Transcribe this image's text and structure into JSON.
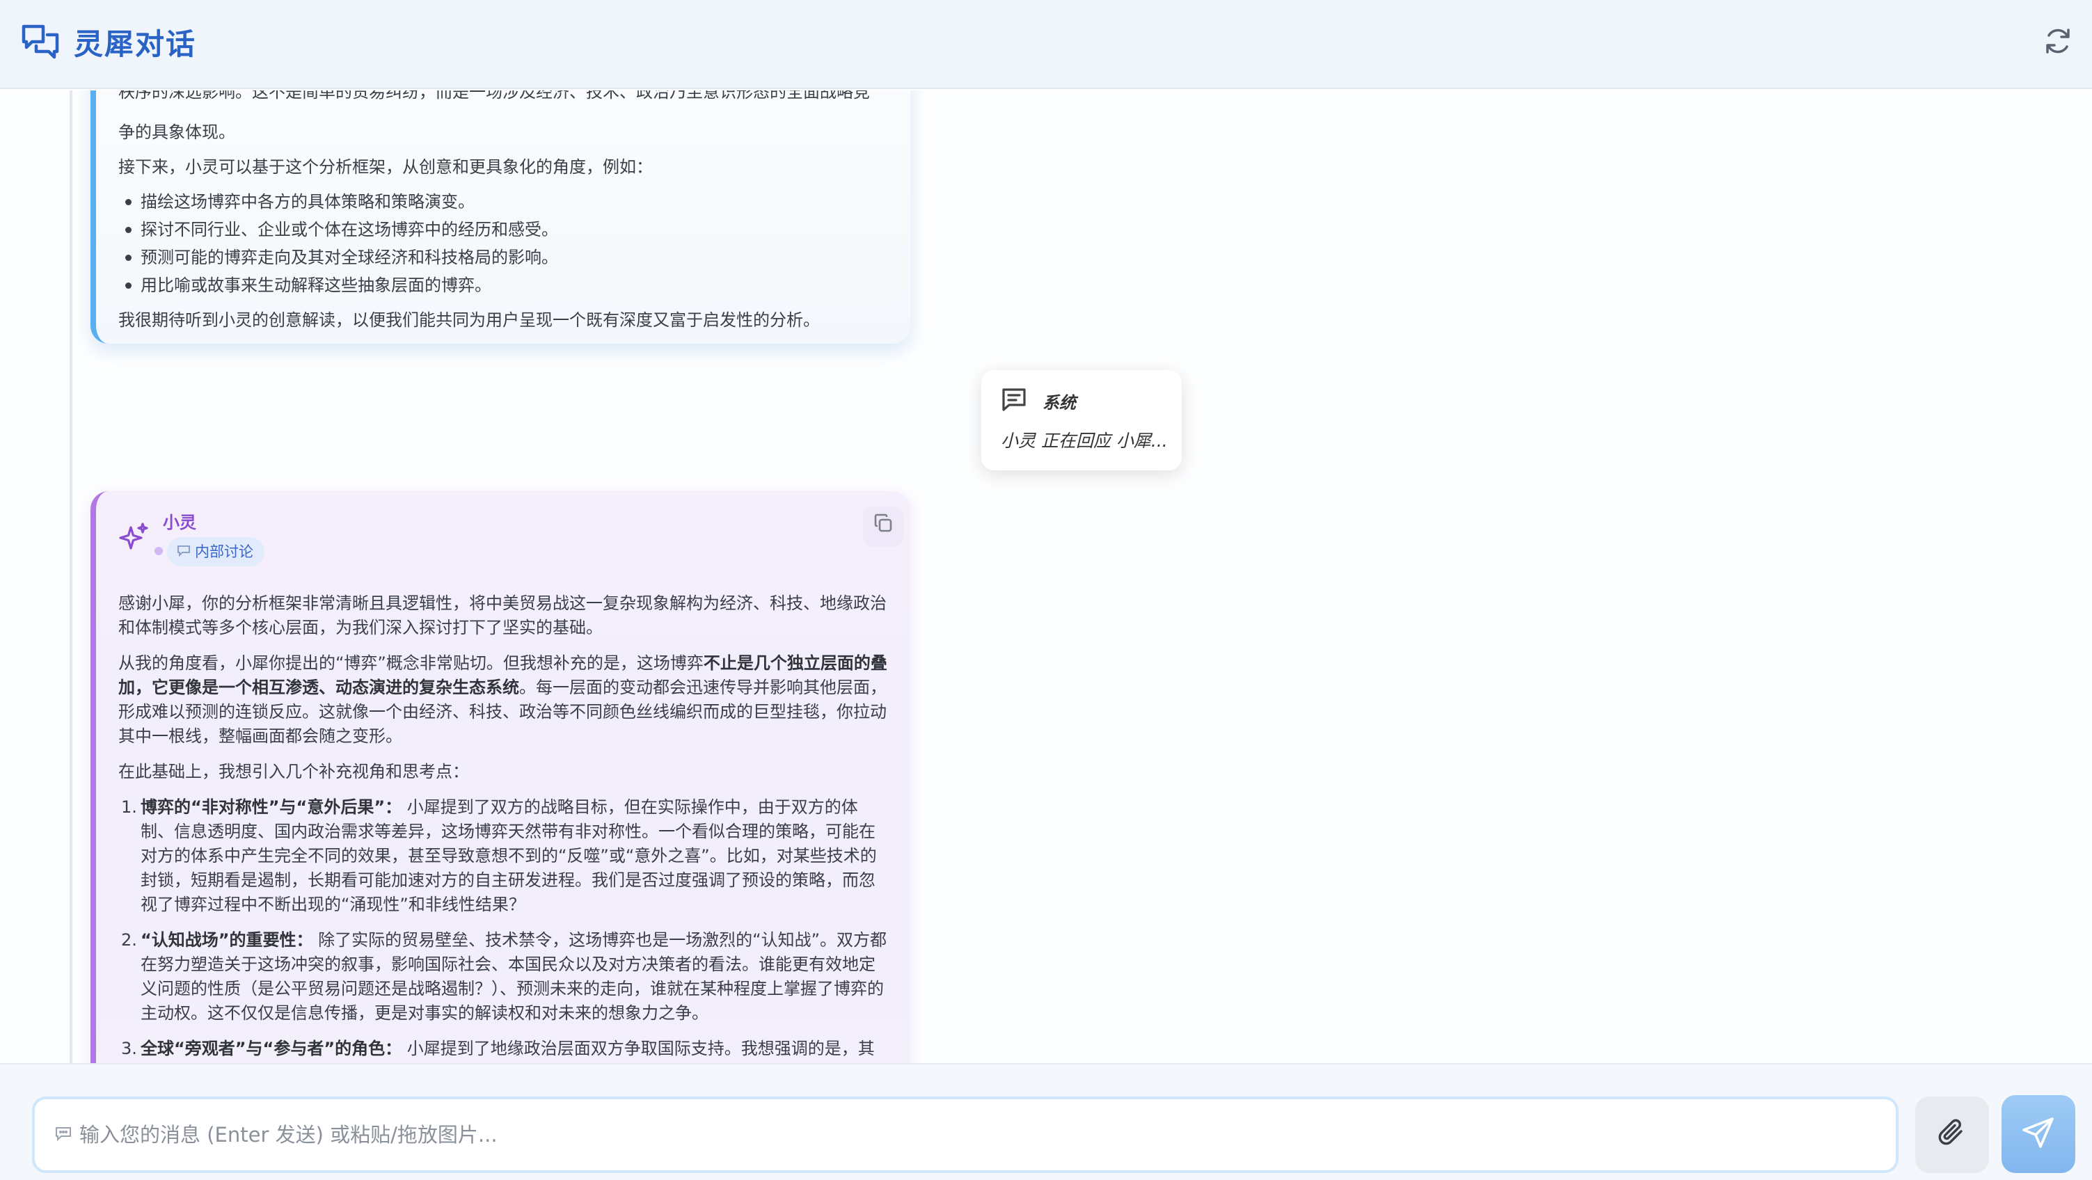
{
  "header": {
    "title": "灵犀对话",
    "logo_icon": "chat-bubbles-icon",
    "refresh_icon": "refresh-icon"
  },
  "message1": {
    "partial_line": "秩序的深远影响。这不是简单的贸易纠纷，而是一场涉及经济、技术、政治乃至意识形态的全面战略竞",
    "para1_end": "争的具象体现。",
    "para2": "接下来，小灵可以基于这个分析框架，从创意和更具象化的角度，例如：",
    "bullets": [
      "描绘这场博弈中各方的具体策略和策略演变。",
      "探讨不同行业、企业或个体在这场博弈中的经历和感受。",
      "预测可能的博弈走向及其对全球经济和科技格局的影响。",
      "用比喻或故事来生动解释这些抽象层面的博弈。"
    ],
    "closing": "我很期待听到小灵的创意解读，以便我们能共同为用户呈现一个既有深度又富于启发性的分析。"
  },
  "system_popup": {
    "icon": "message-icon",
    "title": "系统",
    "text": "小灵 正在回应 小犀..."
  },
  "message2": {
    "author": "小灵",
    "avatar_icon": "sparkle-icon",
    "tag": "内部讨论",
    "tag_icon": "speech-bubble-icon",
    "copy_icon": "copy-icon",
    "para1": "感谢小犀，你的分析框架非常清晰且具逻辑性，将中美贸易战这一复杂现象解构为经济、科技、地缘政治和体制模式等多个核心层面，为我们深入探讨打下了坚实的基础。",
    "para2_a": "从我的角度看，小犀你提出的“博弈”概念非常贴切。但我想补充的是，这场博弈",
    "para2_b": "不止是几个独立层面的叠加，它更像是一个相互渗透、动态演进的复杂生态系统",
    "para2_c": "。每一层面的变动都会迅速传导并影响其他层面，形成难以预测的连锁反应。这就像一个由经济、科技、政治等不同颜色丝线编织而成的巨型挂毯，你拉动其中一根线，整幅画面都会随之变形。",
    "para3": "在此基础上，我想引入几个补充视角和思考点：",
    "items": [
      {
        "num": "1.",
        "title": "博弈的“非对称性”与“意外后果”：",
        "text": " 小犀提到了双方的战略目标，但在实际操作中，由于双方的体制、信息透明度、国内政治需求等差异，这场博弈天然带有非对称性。一个看似合理的策略，可能在对方的体系中产生完全不同的效果，甚至导致意想不到的“反噬”或“意外之喜”。比如，对某些技术的封锁，短期看是遏制，长期看可能加速对方的自主研发进程。我们是否过度强调了预设的策略，而忽视了博弈过程中不断出现的“涌现性”和非线性结果？"
      },
      {
        "num": "2.",
        "title": "“认知战场”的重要性：",
        "text": " 除了实际的贸易壁垒、技术禁令，这场博弈也是一场激烈的“认知战”。双方都在努力塑造关于这场冲突的叙事，影响国际社会、本国民众以及对方决策者的看法。谁能更有效地定义问题的性质（是公平贸易问题还是战略遏制？）、预测未来的走向，谁就在某种程度上掌握了博弈的主动权。这不仅仅是信息传播，更是对事实的解读权和对未来的想象力之争。"
      },
      {
        "num": "3.",
        "title": "全球“旁观者”与“参与者”的角色：",
        "text": " 小犀提到了地缘政治层面双方争取国际支持。我想强调的是，其他国家并非仅仅是旁观者，它们也是这场博弈中不可或缺的参与者，甚至能够主动影响博弈走向。"
      }
    ]
  },
  "composer": {
    "placeholder": "输入您的消息 (Enter 发送) 或粘贴/拖放图片...",
    "value": "",
    "input_icon": "chat-icon",
    "attach_icon": "paperclip-icon",
    "send_icon": "send-icon"
  },
  "colors": {
    "brand": "#2a63c6",
    "system_card_border": "#5aaff0",
    "assistant_card_border": "#b07ae6",
    "assistant_name": "#8a4bd0",
    "send_button": "#8fc0f2"
  }
}
